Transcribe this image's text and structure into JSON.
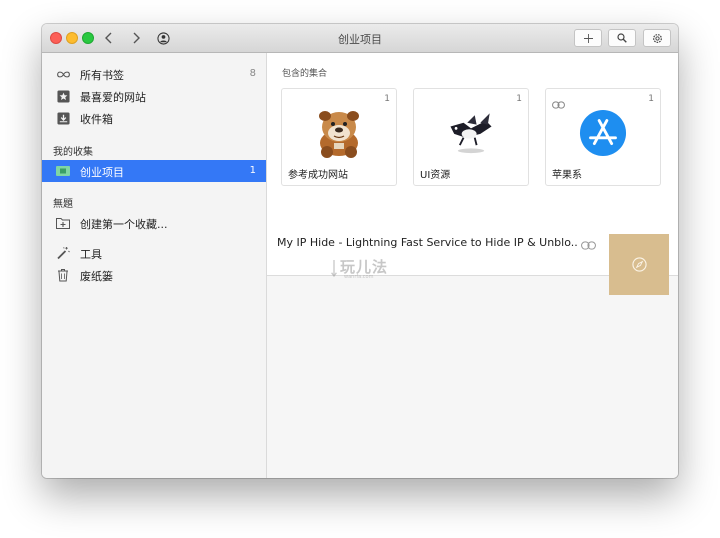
{
  "window": {
    "title": "创业项目"
  },
  "toolbar": {
    "back_icon": "chevron-left",
    "forward_icon": "chevron-right",
    "profile_icon": "user-circle",
    "add_icon": "plus",
    "search_icon": "magnifier",
    "settings_icon": "gear"
  },
  "sidebar": {
    "items": [
      {
        "label": "所有书签",
        "count": "8",
        "icon": "infinity"
      },
      {
        "label": "最喜爱的网站",
        "icon": "star-box"
      },
      {
        "label": "收件箱",
        "icon": "inbox-tray"
      }
    ],
    "my_collections": {
      "title": "我的收集",
      "items": [
        {
          "label": "创业项目",
          "count": "1",
          "icon": "folder-card"
        }
      ]
    },
    "untitled": {
      "title": "無題",
      "items": [
        {
          "label": "创建第一个收藏...",
          "icon": "folder-plus"
        }
      ]
    },
    "tools": [
      {
        "label": "工具",
        "icon": "magic-wand"
      },
      {
        "label": "废纸篓",
        "icon": "trash"
      }
    ]
  },
  "main": {
    "section_title": "包含的集合",
    "collections": [
      {
        "name": "参考成功网站",
        "count": "1",
        "icon": "bulldog"
      },
      {
        "name": "UI资源",
        "count": "1",
        "icon": "flying-bird-dog"
      },
      {
        "name": "苹果系",
        "count": "1",
        "icon": "app-store-icon",
        "has_link_icon": true
      }
    ],
    "bookmarks": [
      {
        "title": "My IP Hide - Lightning Fast Service to Hide IP & Unblo...",
        "link_icon": "link-icon",
        "thumb_icon": "compass-icon",
        "thumb_color": "#d8bd8f"
      }
    ]
  },
  "watermark": {
    "text": "玩儿法",
    "sub": "wanrfa.com"
  },
  "colors": {
    "accent": "#3478f6",
    "appstore": "#1e8ef0",
    "thumb": "#d8bd8f"
  }
}
